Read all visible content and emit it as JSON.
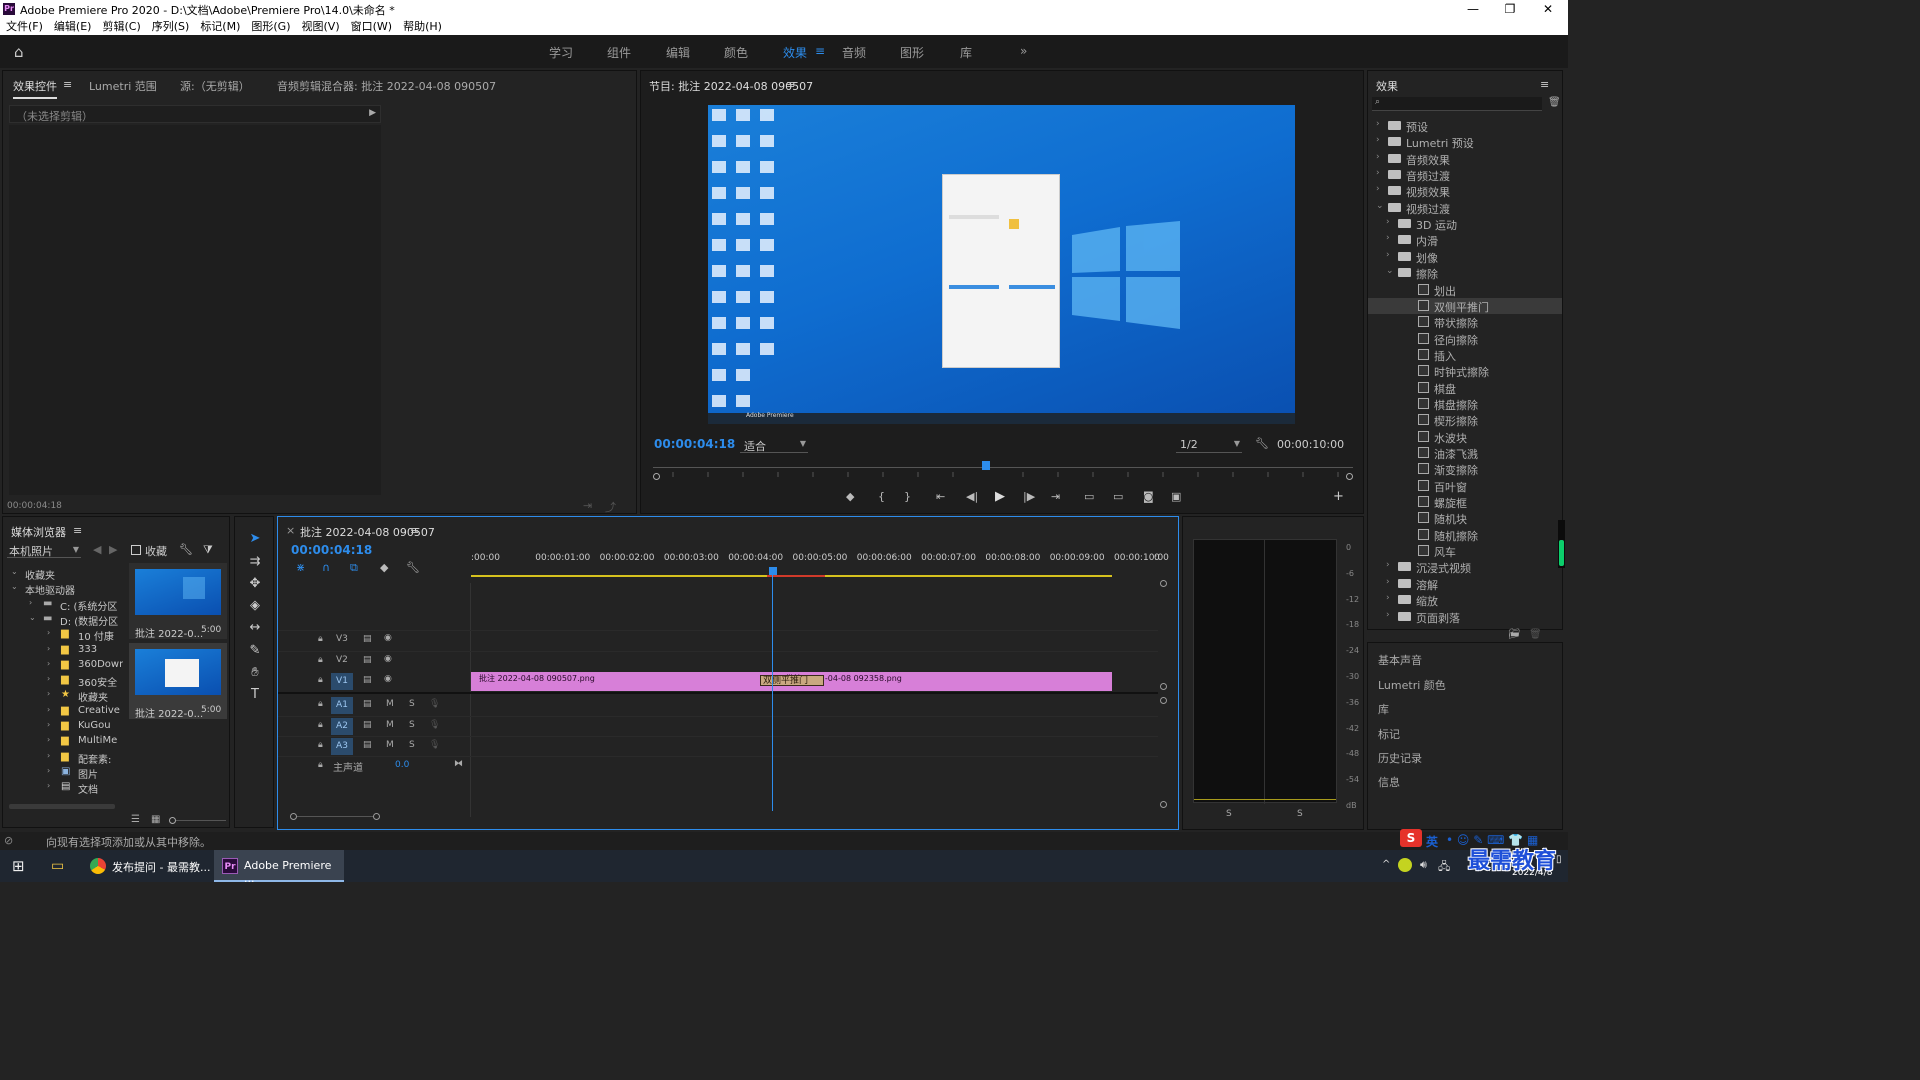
{
  "window": {
    "title": "Adobe Premiere Pro 2020 - D:\\文档\\Adobe\\Premiere Pro\\14.0\\未命名 *",
    "logo": "Pr"
  },
  "menu": [
    "文件(F)",
    "编辑(E)",
    "剪辑(C)",
    "序列(S)",
    "标记(M)",
    "图形(G)",
    "视图(V)",
    "窗口(W)",
    "帮助(H)"
  ],
  "workspaces": [
    {
      "label": "学习",
      "active": false
    },
    {
      "label": "组件",
      "active": false
    },
    {
      "label": "编辑",
      "active": false
    },
    {
      "label": "颜色",
      "active": false
    },
    {
      "label": "效果",
      "active": true
    },
    {
      "label": "音频",
      "active": false
    },
    {
      "label": "图形",
      "active": false
    },
    {
      "label": "库",
      "active": false
    }
  ],
  "source_panel": {
    "tabs": [
      "效果控件",
      "Lumetri 范围",
      "源:（无剪辑）",
      "音频剪辑混合器: 批注 2022-04-08 090507"
    ],
    "empty_text": "（未选择剪辑）",
    "timecode": "00:00:04:18"
  },
  "program_monitor": {
    "title": "节目: 批注 2022-04-08 090507",
    "timecode": "00:00:04:18",
    "fit": "适合",
    "resolution": "1/2",
    "duration": "00:00:10:00",
    "playhead_position": 0.47,
    "taskbar_preview": "Adobe Premiere"
  },
  "media_browser": {
    "title": "媒体浏览器",
    "location": "本机照片",
    "favorites_label": "收藏",
    "tree": [
      {
        "label": "收藏夹",
        "depth": 0,
        "icon": "none"
      },
      {
        "label": "本地驱动器",
        "depth": 0,
        "icon": "none"
      },
      {
        "label": "C: (系统分区",
        "depth": 1,
        "icon": "drive"
      },
      {
        "label": "D: (数据分区",
        "depth": 1,
        "icon": "drive"
      },
      {
        "label": "10 付康",
        "depth": 2,
        "icon": "folder"
      },
      {
        "label": "333",
        "depth": 2,
        "icon": "folder"
      },
      {
        "label": "360Down",
        "depth": 2,
        "icon": "folder"
      },
      {
        "label": "360安全",
        "depth": 2,
        "icon": "folder"
      },
      {
        "label": "收藏夹",
        "depth": 2,
        "icon": "star"
      },
      {
        "label": "Creative",
        "depth": 2,
        "icon": "folder"
      },
      {
        "label": "KuGou",
        "depth": 2,
        "icon": "folder"
      },
      {
        "label": "MultiMe",
        "depth": 2,
        "icon": "folder"
      },
      {
        "label": "配套素:",
        "depth": 2,
        "icon": "folder"
      },
      {
        "label": "图片",
        "depth": 2,
        "icon": "pic"
      },
      {
        "label": "文档",
        "depth": 2,
        "icon": "doc"
      }
    ],
    "thumbnails": [
      {
        "name": "批注 2022-0...",
        "duration": "5:00"
      },
      {
        "name": "批注 2022-0...",
        "duration": "5:00"
      }
    ]
  },
  "timeline": {
    "tab": "批注 2022-04-08 090507",
    "timecode": "00:00:04:18",
    "ruler": [
      ":00:00",
      "00:00:01:00",
      "00:00:02:00",
      "00:00:03:00",
      "00:00:04:00",
      "00:00:05:00",
      "00:00:06:00",
      "00:00:07:00",
      "00:00:08:00",
      "00:00:09:00",
      "00:00:10:00",
      "0"
    ],
    "video_tracks": [
      "V3",
      "V2",
      "V1"
    ],
    "audio_tracks": [
      "A1",
      "A2",
      "A3"
    ],
    "master": {
      "label": "主声道",
      "value": "0.0"
    },
    "track_m": "M",
    "track_s": "S",
    "clips": [
      {
        "label": "批注 2022-04-08 090507.png"
      },
      {
        "label": "批注 2022-04-08 092358.png"
      }
    ],
    "transition": "双侧平推门"
  },
  "audio_meter": {
    "ticks": [
      "0",
      "-6",
      "-12",
      "-18",
      "-24",
      "-30",
      "-36",
      "-42",
      "-48",
      "-54",
      "dB"
    ],
    "solo": [
      "S",
      "S"
    ]
  },
  "effects_panel": {
    "title": "效果",
    "items": [
      {
        "label": "预设",
        "depth": 0,
        "kind": "folder",
        "open": false
      },
      {
        "label": "Lumetri 预设",
        "depth": 0,
        "kind": "folder",
        "open": false
      },
      {
        "label": "音频效果",
        "depth": 0,
        "kind": "folder",
        "open": false
      },
      {
        "label": "音频过渡",
        "depth": 0,
        "kind": "folder",
        "open": false
      },
      {
        "label": "视频效果",
        "depth": 0,
        "kind": "folder",
        "open": false
      },
      {
        "label": "视频过渡",
        "depth": 0,
        "kind": "folder",
        "open": true
      },
      {
        "label": "3D 运动",
        "depth": 1,
        "kind": "folder",
        "open": false
      },
      {
        "label": "内滑",
        "depth": 1,
        "kind": "folder",
        "open": false
      },
      {
        "label": "划像",
        "depth": 1,
        "kind": "folder",
        "open": false
      },
      {
        "label": "擦除",
        "depth": 1,
        "kind": "folder",
        "open": true
      },
      {
        "label": "划出",
        "depth": 2,
        "kind": "fx"
      },
      {
        "label": "双侧平推门",
        "depth": 2,
        "kind": "fx",
        "selected": true
      },
      {
        "label": "带状擦除",
        "depth": 2,
        "kind": "fx"
      },
      {
        "label": "径向擦除",
        "depth": 2,
        "kind": "fx"
      },
      {
        "label": "插入",
        "depth": 2,
        "kind": "fx"
      },
      {
        "label": "时钟式擦除",
        "depth": 2,
        "kind": "fx"
      },
      {
        "label": "棋盘",
        "depth": 2,
        "kind": "fx"
      },
      {
        "label": "棋盘擦除",
        "depth": 2,
        "kind": "fx"
      },
      {
        "label": "楔形擦除",
        "depth": 2,
        "kind": "fx"
      },
      {
        "label": "水波块",
        "depth": 2,
        "kind": "fx"
      },
      {
        "label": "油漆飞溅",
        "depth": 2,
        "kind": "fx"
      },
      {
        "label": "渐变擦除",
        "depth": 2,
        "kind": "fx"
      },
      {
        "label": "百叶窗",
        "depth": 2,
        "kind": "fx"
      },
      {
        "label": "螺旋框",
        "depth": 2,
        "kind": "fx"
      },
      {
        "label": "随机块",
        "depth": 2,
        "kind": "fx"
      },
      {
        "label": "随机擦除",
        "depth": 2,
        "kind": "fx"
      },
      {
        "label": "风车",
        "depth": 2,
        "kind": "fx"
      },
      {
        "label": "沉浸式视频",
        "depth": 1,
        "kind": "folder",
        "open": false
      },
      {
        "label": "溶解",
        "depth": 1,
        "kind": "folder",
        "open": false
      },
      {
        "label": "缩放",
        "depth": 1,
        "kind": "folder",
        "open": false
      },
      {
        "label": "页面剥落",
        "depth": 1,
        "kind": "folder",
        "open": false
      }
    ],
    "side_panels": [
      "基本声音",
      "Lumetri 颜色",
      "库",
      "标记",
      "历史记录",
      "信息"
    ]
  },
  "status_bar": "向现有选择项添加或从其中移除。",
  "taskbar": {
    "items": [
      "发布提问 - 最需教...",
      "Adobe Premiere ..."
    ],
    "ime": "英",
    "time_date": "2022/4/8",
    "watermark": "最需教育"
  }
}
